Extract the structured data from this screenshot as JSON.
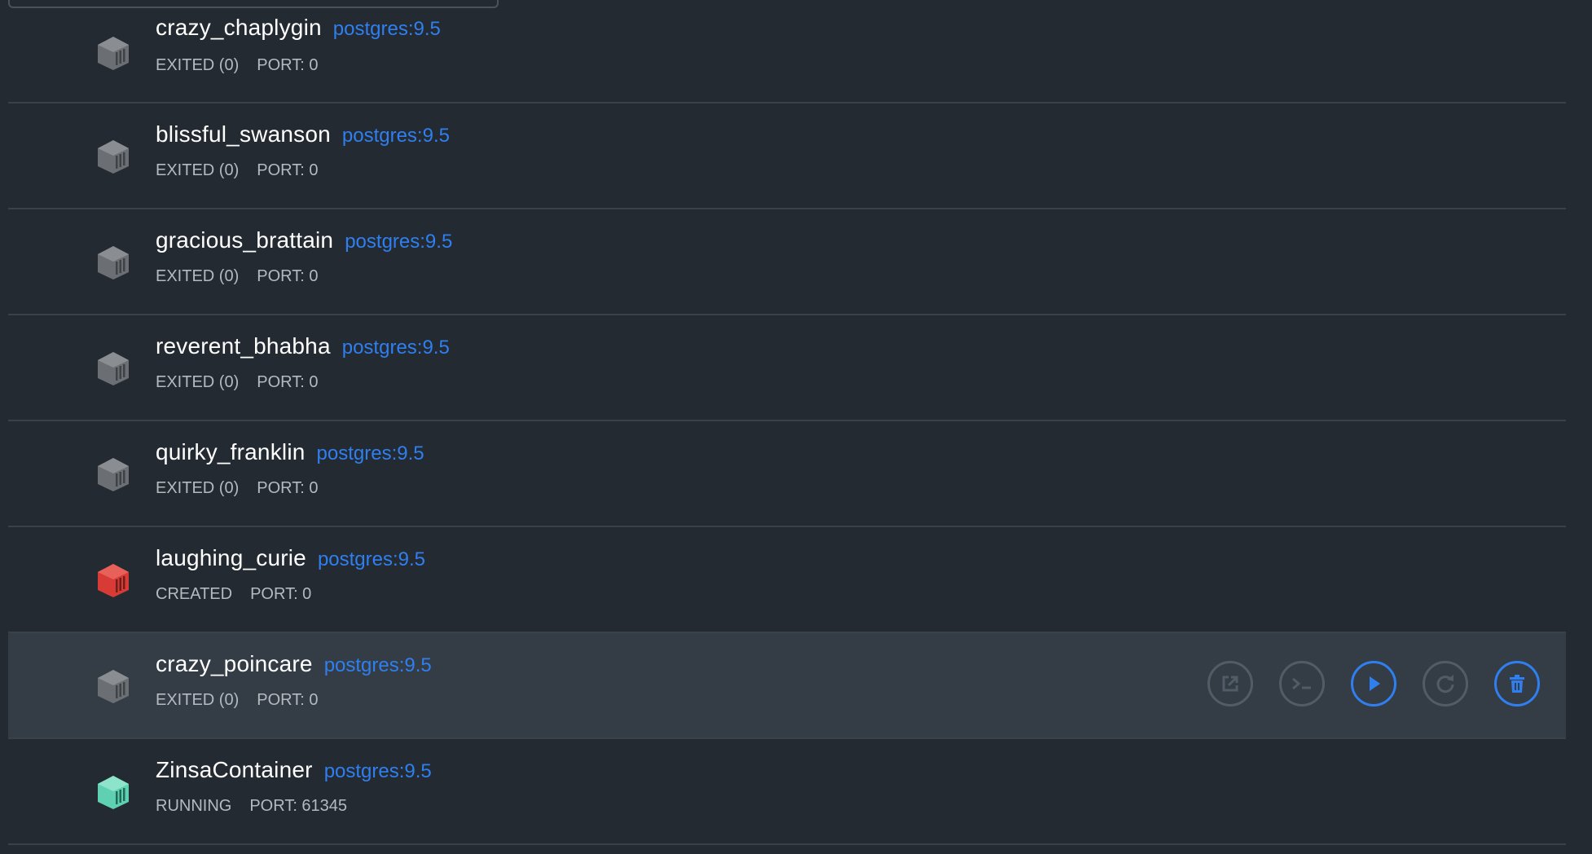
{
  "colors": {
    "background": "#232a31",
    "hover_row": "#343d45",
    "accent": "#2f7ff0",
    "status_exited": "#6b6f73",
    "status_created": "#e0453f",
    "status_running": "#5fd0b1"
  },
  "containers": [
    {
      "name": "crazy_chaplygin",
      "image": "postgres:9.5",
      "status": "EXITED (0)",
      "port": "PORT: 0",
      "state_icon": "container-exited-icon"
    },
    {
      "name": "blissful_swanson",
      "image": "postgres:9.5",
      "status": "EXITED (0)",
      "port": "PORT: 0",
      "state_icon": "container-exited-icon"
    },
    {
      "name": "gracious_brattain",
      "image": "postgres:9.5",
      "status": "EXITED (0)",
      "port": "PORT: 0",
      "state_icon": "container-exited-icon"
    },
    {
      "name": "reverent_bhabha",
      "image": "postgres:9.5",
      "status": "EXITED (0)",
      "port": "PORT: 0",
      "state_icon": "container-exited-icon"
    },
    {
      "name": "quirky_franklin",
      "image": "postgres:9.5",
      "status": "EXITED (0)",
      "port": "PORT: 0",
      "state_icon": "container-exited-icon"
    },
    {
      "name": "laughing_curie",
      "image": "postgres:9.5",
      "status": "CREATED",
      "port": "PORT: 0",
      "state_icon": "container-created-icon"
    },
    {
      "name": "crazy_poincare",
      "image": "postgres:9.5",
      "status": "EXITED (0)",
      "port": "PORT: 0",
      "state_icon": "container-exited-icon"
    },
    {
      "name": "ZinsaContainer",
      "image": "postgres:9.5",
      "status": "RUNNING",
      "port": "PORT: 61345",
      "state_icon": "container-running-icon"
    }
  ],
  "hover_actions": [
    {
      "icon": "open-external-icon",
      "enabled": false
    },
    {
      "icon": "terminal-icon",
      "enabled": false
    },
    {
      "icon": "play-icon",
      "enabled": true
    },
    {
      "icon": "restart-icon",
      "enabled": false
    },
    {
      "icon": "trash-icon",
      "enabled": true
    }
  ]
}
